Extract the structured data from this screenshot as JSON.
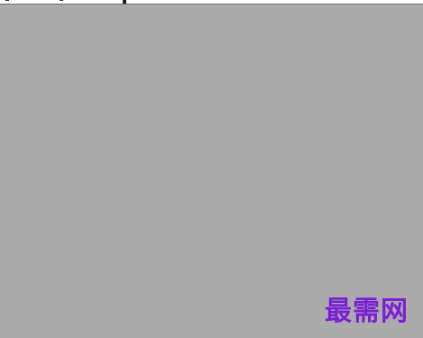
{
  "workspace": {
    "background_color": "#ababab"
  },
  "top_strip": {
    "background_color": "#ffffff",
    "border_color": "#6e6e6e"
  },
  "watermark": {
    "text": "最需网",
    "color": "#7b1fd6"
  }
}
